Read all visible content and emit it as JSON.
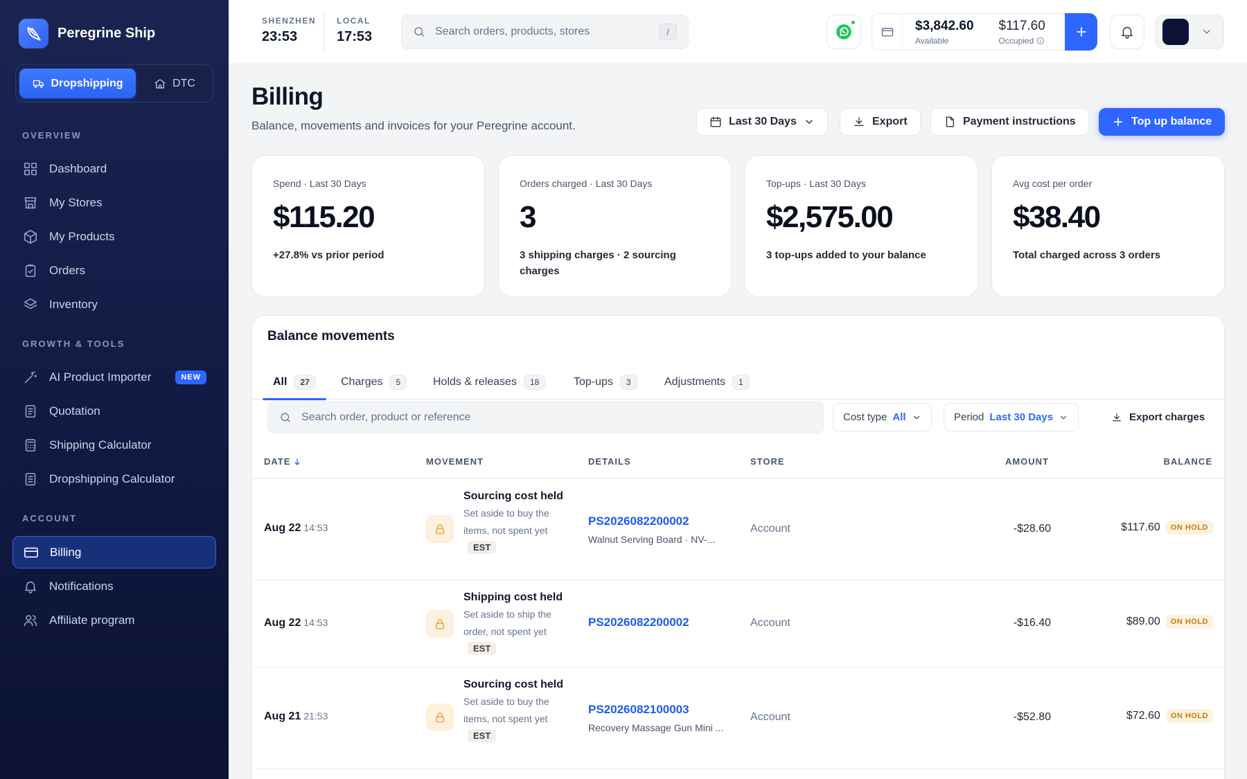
{
  "brand": {
    "name": "Peregrine Ship"
  },
  "mode": {
    "active": "Dropshipping",
    "inactive": "DTC"
  },
  "sidebar": {
    "sections": [
      {
        "title": "OVERVIEW",
        "items": [
          "Dashboard",
          "My Stores",
          "My Products",
          "Orders",
          "Inventory"
        ]
      },
      {
        "title": "GROWTH & TOOLS",
        "items": [
          "AI Product Importer",
          "Quotation",
          "Shipping Calculator",
          "Dropshipping Calculator"
        ],
        "badge": "NEW"
      },
      {
        "title": "ACCOUNT",
        "items": [
          "Billing",
          "Notifications",
          "Affiliate program"
        ]
      }
    ]
  },
  "topbar": {
    "clocks": [
      {
        "label": "SHENZHEN",
        "time": "23:53"
      },
      {
        "label": "LOCAL",
        "time": "17:53"
      }
    ],
    "search_placeholder": "Search orders, products, stores",
    "search_key": "/",
    "wallet": {
      "available": "$3,842.60",
      "available_label": "Available",
      "occupied": "$117.60",
      "occupied_label": "Occupied"
    }
  },
  "page": {
    "title": "Billing",
    "subtitle": "Balance, movements and invoices for your Peregrine account.",
    "actions": {
      "period": "Last 30 Days",
      "export": "Export",
      "payment": "Payment instructions",
      "topup": "Top up balance"
    }
  },
  "stats": [
    {
      "label": "Spend · Last 30 Days",
      "value": "$115.20",
      "note": "+27.8% vs prior period"
    },
    {
      "label": "Orders charged · Last 30 Days",
      "value": "3",
      "note": "3 shipping charges · 2 sourcing charges"
    },
    {
      "label": "Top-ups · Last 30 Days",
      "value": "$2,575.00",
      "note": "3 top-ups added to your balance"
    },
    {
      "label": "Avg cost per order",
      "value": "$38.40",
      "note": "Total charged across 3 orders"
    }
  ],
  "movements": {
    "title": "Balance movements",
    "tabs": [
      {
        "label": "All",
        "count": "27"
      },
      {
        "label": "Charges",
        "count": "5"
      },
      {
        "label": "Holds & releases",
        "count": "18"
      },
      {
        "label": "Top-ups",
        "count": "3"
      },
      {
        "label": "Adjustments",
        "count": "1"
      }
    ],
    "search_placeholder": "Search order, product or reference",
    "filters": {
      "cost_type_label": "Cost type",
      "cost_type_value": "All",
      "period_label": "Period",
      "period_value": "Last 30 Days",
      "export": "Export charges"
    },
    "columns": {
      "date": "DATE",
      "movement": "MOVEMENT",
      "details": "DETAILS",
      "store": "STORE",
      "amount": "AMOUNT",
      "balance": "BALANCE"
    },
    "rows": [
      {
        "date": "Aug 22",
        "time": "14:53",
        "title": "Sourcing cost held",
        "desc": "Set aside to buy the items, not spent yet",
        "tag": "EST",
        "ref": "PS2026082200002",
        "product": "Walnut Serving Board · NV-...",
        "store": "Account",
        "amount": "-$28.60",
        "balance": "$117.60",
        "status": "ON HOLD"
      },
      {
        "date": "Aug 22",
        "time": "14:53",
        "title": "Shipping cost held",
        "desc": "Set aside to ship the order, not spent yet",
        "tag": "EST",
        "ref": "PS2026082200002",
        "product": "",
        "store": "Account",
        "amount": "-$16.40",
        "balance": "$89.00",
        "status": "ON HOLD"
      },
      {
        "date": "Aug 21",
        "time": "21:53",
        "title": "Sourcing cost held",
        "desc": "Set aside to buy the items, not spent yet",
        "tag": "EST",
        "ref": "PS2026082100003",
        "product": "Recovery Massage Gun Mini ...",
        "store": "Account",
        "amount": "-$52.80",
        "balance": "$72.60",
        "status": "ON HOLD"
      }
    ]
  }
}
